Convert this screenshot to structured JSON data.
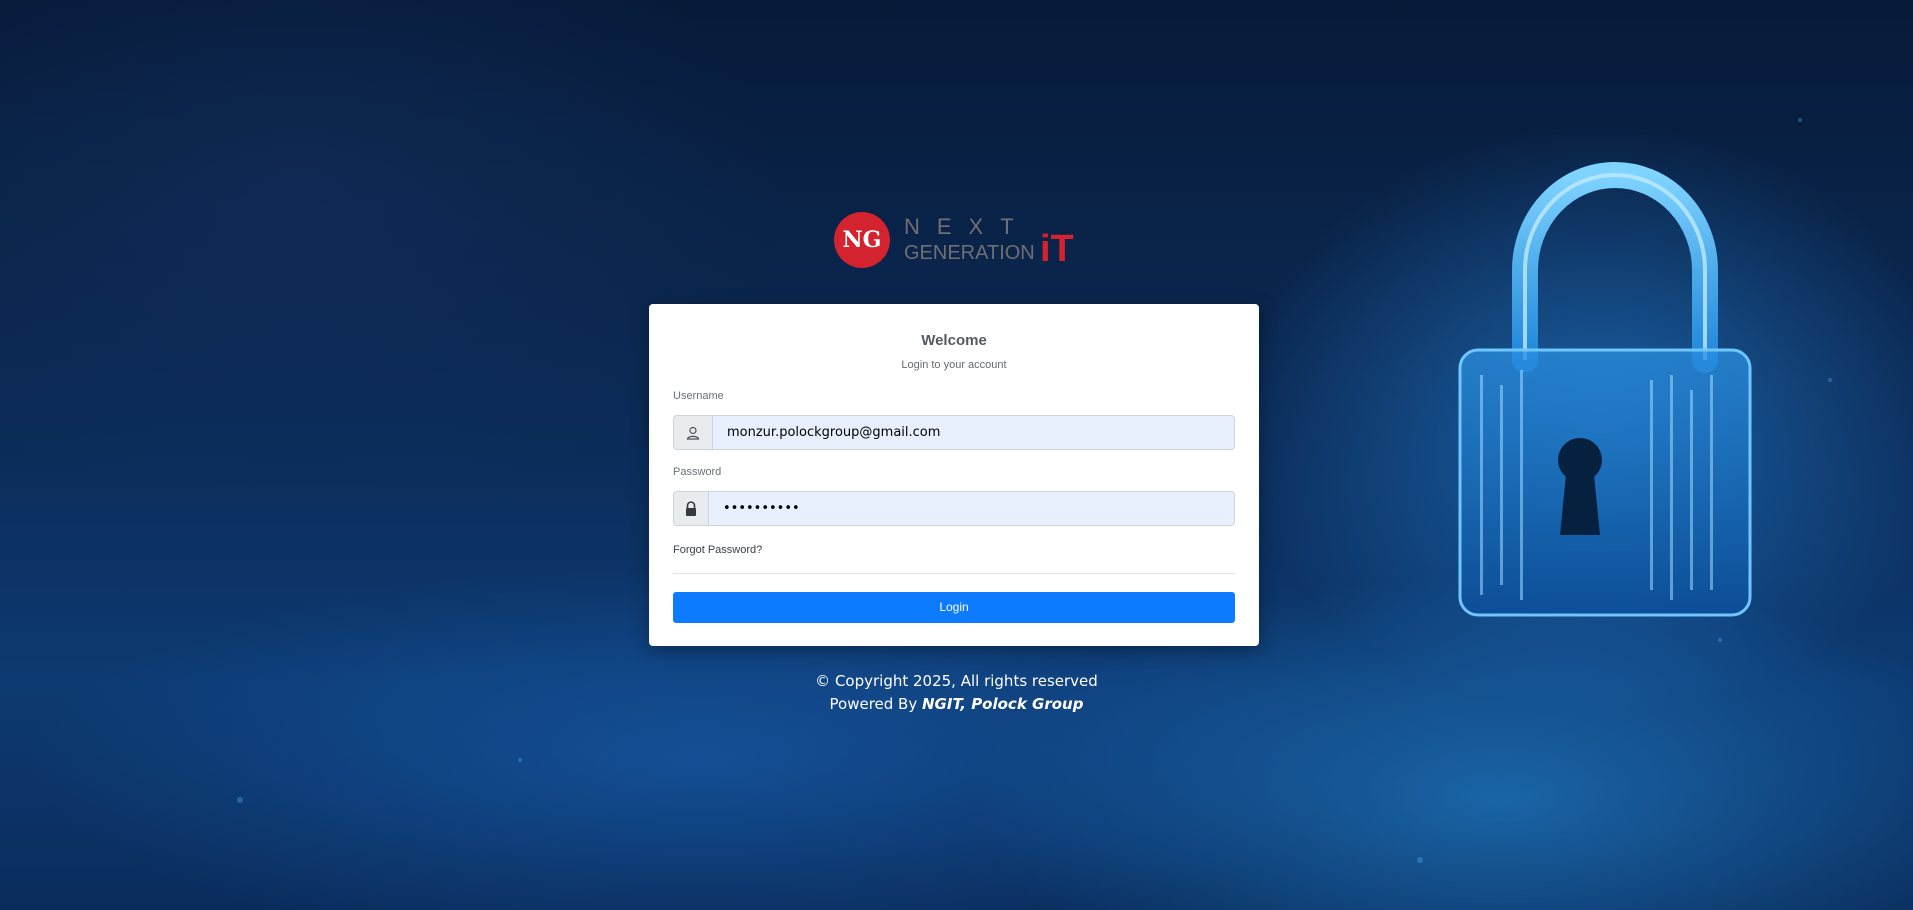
{
  "logo": {
    "mark": "NG",
    "top_text": "NEXT",
    "bottom_text": "GENERATION",
    "accent_text": "iT",
    "accent_color": "#d3232f"
  },
  "card": {
    "title": "Welcome",
    "subtitle": "Login to your account"
  },
  "username": {
    "label": "Username",
    "value": "monzur.polockgroup@gmail.com",
    "icon": "user-icon"
  },
  "password": {
    "label": "Password",
    "value": "••••••••••",
    "icon": "lock-icon"
  },
  "forgot_password": "Forgot Password?",
  "login_button": "Login",
  "footer": {
    "copyright": "© Copyright 2025, All rights reserved",
    "powered_prefix": "Powered By ",
    "powered_by": "NGIT, Polock Group"
  },
  "colors": {
    "primary_button": "#0d7bff",
    "input_background": "#e8f0fe",
    "background_dark": "#071a38"
  }
}
